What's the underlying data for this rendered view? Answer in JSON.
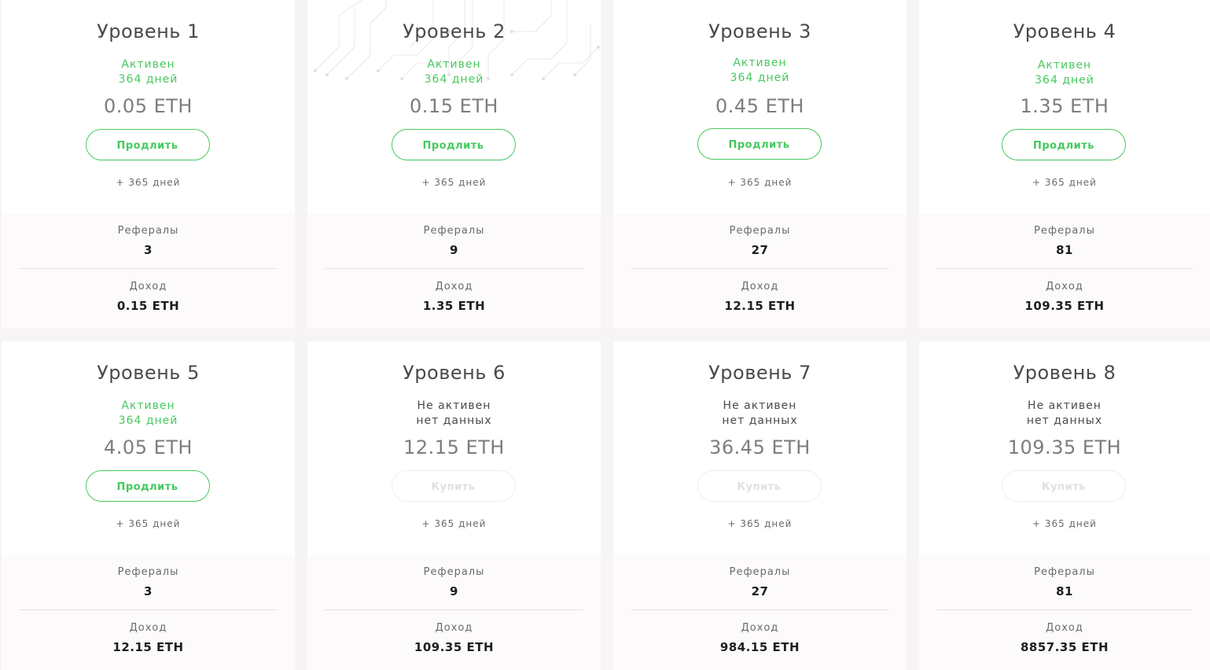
{
  "levels": [
    {
      "title": "Уровень 1",
      "status": "Активен",
      "days": "364 дней",
      "active": true,
      "price": "0.05 ETH",
      "button": "Продлить",
      "extra": "+ 365 дней",
      "referrals_label": "Рефералы",
      "referrals": "3",
      "income_label": "Доход",
      "income": "0.15 ETH"
    },
    {
      "title": "Уровень 2",
      "status": "Активен",
      "days": "364 дней",
      "active": true,
      "price": "0.15 ETH",
      "button": "Продлить",
      "extra": "+ 365 дней",
      "referrals_label": "Рефералы",
      "referrals": "9",
      "income_label": "Доход",
      "income": "1.35 ETH"
    },
    {
      "title": "Уровень 3",
      "status": "Активен",
      "days": "364 дней",
      "active": true,
      "price": "0.45 ETH",
      "button": "Продлить",
      "extra": "+ 365 дней",
      "referrals_label": "Рефералы",
      "referrals": "27",
      "income_label": "Доход",
      "income": "12.15 ETH"
    },
    {
      "title": "Уровень 4",
      "status": "Активен",
      "days": "364 дней",
      "active": true,
      "price": "1.35 ETH",
      "button": "Продлить",
      "extra": "+ 365 дней",
      "referrals_label": "Рефералы",
      "referrals": "81",
      "income_label": "Доход",
      "income": "109.35 ETH"
    },
    {
      "title": "Уровень 5",
      "status": "Активен",
      "days": "364 дней",
      "active": true,
      "price": "4.05 ETH",
      "button": "Продлить",
      "extra": "+ 365 дней",
      "referrals_label": "Рефералы",
      "referrals": "3",
      "income_label": "Доход",
      "income": "12.15 ETH"
    },
    {
      "title": "Уровень 6",
      "status": "Не активен",
      "days": "нет данных",
      "active": false,
      "price": "12.15 ETH",
      "button": "Купить",
      "extra": "+ 365 дней",
      "referrals_label": "Рефералы",
      "referrals": "9",
      "income_label": "Доход",
      "income": "109.35 ETH"
    },
    {
      "title": "Уровень 7",
      "status": "Не активен",
      "days": "нет данных",
      "active": false,
      "price": "36.45 ETH",
      "button": "Купить",
      "extra": "+ 365 дней",
      "referrals_label": "Рефералы",
      "referrals": "27",
      "income_label": "Доход",
      "income": "984.15 ETH"
    },
    {
      "title": "Уровень 8",
      "status": "Не активен",
      "days": "нет данных",
      "active": false,
      "price": "109.35 ETH",
      "button": "Купить",
      "extra": "+ 365 дней",
      "referrals_label": "Рефералы",
      "referrals": "81",
      "income_label": "Доход",
      "income": "8857.35 ETH"
    }
  ],
  "colors": {
    "accent": "#46c95e",
    "background": "#f7f4f6",
    "card": "#ffffff",
    "card_bottom": "#fdfafc",
    "disabled": "#e0e0e0"
  }
}
